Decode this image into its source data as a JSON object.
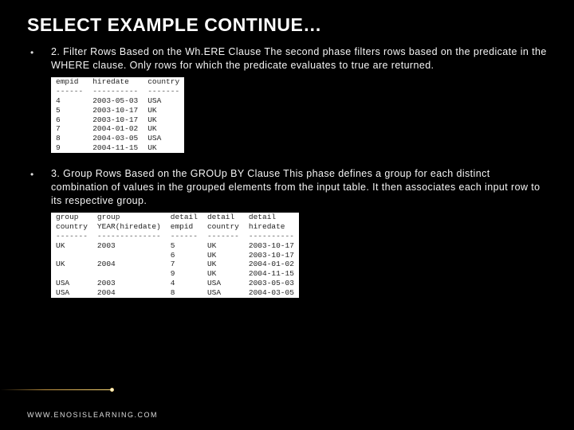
{
  "title": "SELECT EXAMPLE CONTINUE…",
  "bullets": {
    "b1": "2. Filter Rows Based on the Wh.ERE Clause The second phase filters rows based on the predicate in the WHERE clause. Only rows for which the predicate evaluates to true are returned.",
    "b2": "3. Group Rows Based on the GROUp BY Clause This phase defines a group for each distinct combination of values in the grouped elements from the input table. It then associates each input row to its respective group."
  },
  "table1": {
    "headers": [
      "empid",
      "hiredate",
      "country"
    ],
    "dashes": [
      "------",
      "----------",
      "-------"
    ],
    "rows": [
      [
        "4",
        "2003-05-03",
        "USA"
      ],
      [
        "5",
        "2003-10-17",
        "UK"
      ],
      [
        "6",
        "2003-10-17",
        "UK"
      ],
      [
        "7",
        "2004-01-02",
        "UK"
      ],
      [
        "8",
        "2004-03-05",
        "USA"
      ],
      [
        "9",
        "2004-11-15",
        "UK"
      ]
    ]
  },
  "table2": {
    "headers": [
      "group",
      "group",
      "detail",
      "detail",
      "detail"
    ],
    "sub": [
      "country",
      "YEAR(hiredate)",
      "empid",
      "country",
      "hiredate"
    ],
    "dashes": [
      "-------",
      "--------------",
      "------",
      "-------",
      "----------"
    ],
    "rows": [
      [
        "UK",
        "2003",
        "5",
        "UK",
        "2003-10-17"
      ],
      [
        "",
        "",
        "6",
        "UK",
        "2003-10-17"
      ],
      [
        "UK",
        "2004",
        "7",
        "UK",
        "2004-01-02"
      ],
      [
        "",
        "",
        "9",
        "UK",
        "2004-11-15"
      ],
      [
        "USA",
        "2003",
        "4",
        "USA",
        "2003-05-03"
      ],
      [
        "USA",
        "2004",
        "8",
        "USA",
        "2004-03-05"
      ]
    ]
  },
  "footer": "WWW.ENOSISLEARNING.COM"
}
